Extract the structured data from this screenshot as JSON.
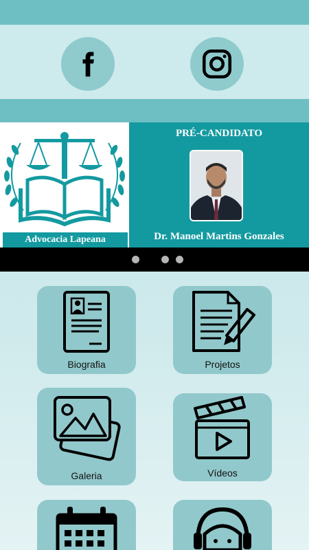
{
  "social": {
    "facebook_icon": "facebook-icon",
    "instagram_icon": "instagram-icon"
  },
  "banner": {
    "left_caption": "Advocacia Lapeana",
    "right_title": "PRÉ-CANDIDATO",
    "right_name": "Dr. Manoel Martins Gonzales"
  },
  "carousel": {
    "dot_count": 3
  },
  "menu": {
    "biografia": "Biografia",
    "projetos": "Projetos",
    "galeria": "Galeria",
    "videos": "Vídeos"
  },
  "colors": {
    "teal": "#139aa0",
    "tile": "#91c8cb",
    "bar": "#6dbfc3"
  }
}
